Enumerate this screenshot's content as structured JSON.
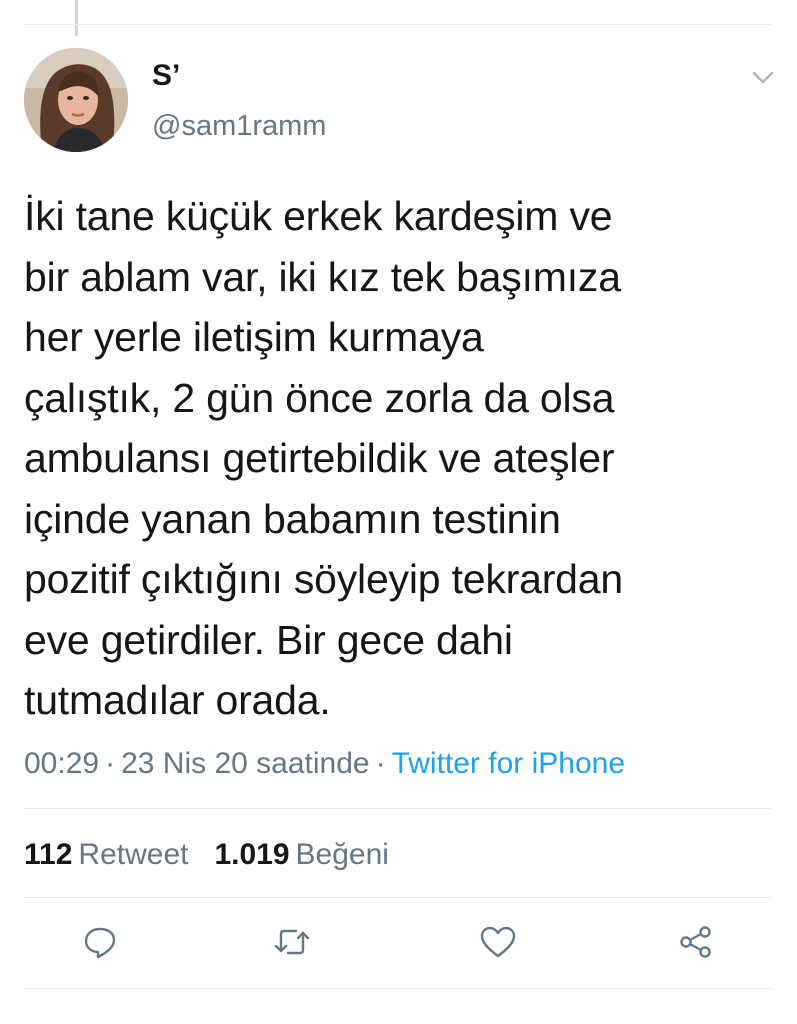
{
  "user": {
    "display_name": "S’",
    "handle": "@sam1ramm",
    "avatar_icon": "avatar-photo"
  },
  "tweet": {
    "text": "İki tane küçük erkek kardeşim ve\nbir ablam var, iki kız tek başımıza\nher yerle iletişim kurmaya\nçalıştık, 2 gün önce zorla da olsa\nambulansı getirtebildik ve ateşler\niçinde yanan babamın testinin\npozitif çıktığını söyleyip tekrardan\neve getirdiler. Bir gece dahi\ntutmadılar orada."
  },
  "meta": {
    "time": "00:29",
    "separator": "·",
    "date": "23 Nis 20 saatinde",
    "source": "Twitter for iPhone"
  },
  "stats": {
    "retweets_count": "112",
    "retweets_label": "Retweet",
    "likes_count": "1.019",
    "likes_label": "Beğeni"
  },
  "actions": {
    "reply_icon": "reply-icon",
    "retweet_icon": "retweet-icon",
    "like_icon": "heart-icon",
    "share_icon": "share-icon"
  },
  "colors": {
    "text": "#14171a",
    "secondary": "#657786",
    "link": "#1da1f2",
    "divider": "#e1e8ed"
  }
}
